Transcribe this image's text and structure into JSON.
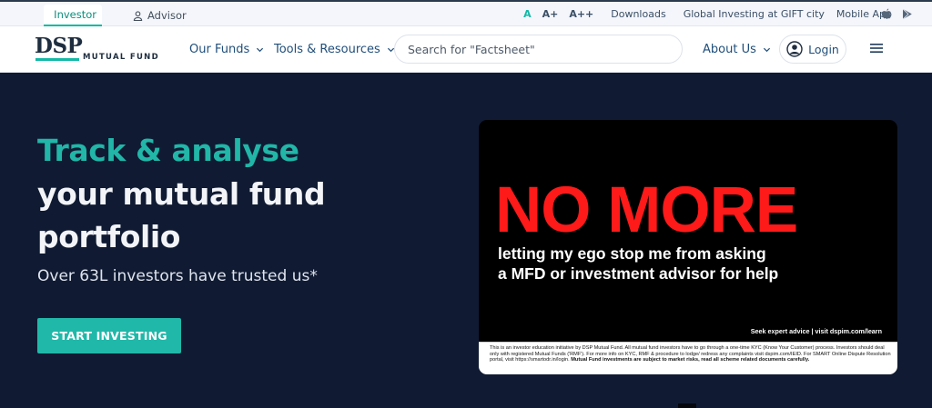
{
  "utility_bar": {
    "investor_tab": "Investor",
    "advisor_tab": "Advisor",
    "font_sizes": [
      "A",
      "A+",
      "A++"
    ],
    "links": [
      "Downloads",
      "Global Investing at GIFT city",
      "Mobile App"
    ],
    "icons": [
      "apple-icon",
      "play-store-icon"
    ]
  },
  "nav": {
    "brand_top": "DSP",
    "brand_bottom": "MUTUAL FUND",
    "items": [
      "Our Funds",
      "Tools & Resources"
    ],
    "search_placeholder": "Search for \"Factsheet\"",
    "about": "About Us",
    "login": "Login"
  },
  "hero": {
    "line1": "Track & analyse",
    "line2": "your mutual fund",
    "line3": "portfolio",
    "subtitle": "Over 63L investors have trusted us*",
    "cta": "START INVESTING"
  },
  "banner": {
    "headline": "NO MORE",
    "body_line1": "letting my ego stop me from asking",
    "body_line2": "a MFD or investment advisor for help",
    "footer_link": "Seek expert advice | visit dspim.com/learn",
    "disclaimer": "This is an investor education initiative by DSP Mutual Fund. All mutual fund investors have to go through a one-time KYC (Know Your Customer) process. Investors should deal only with registered Mutual Funds ('RMF'). For more info on KYC, RMF & procedure to lodge/ redress any complaints visit dspim.com/IEID. For SMART Online Dispute Resolution portal, visit https://smartodr.in/login.",
    "disclaimer_bold": "Mutual Fund investments are subject to market risks, read all scheme related documents carefully."
  },
  "colors": {
    "accent": "#20b8a9",
    "hero_bg": "#101b33",
    "banner_red": "#ff1a1a"
  }
}
